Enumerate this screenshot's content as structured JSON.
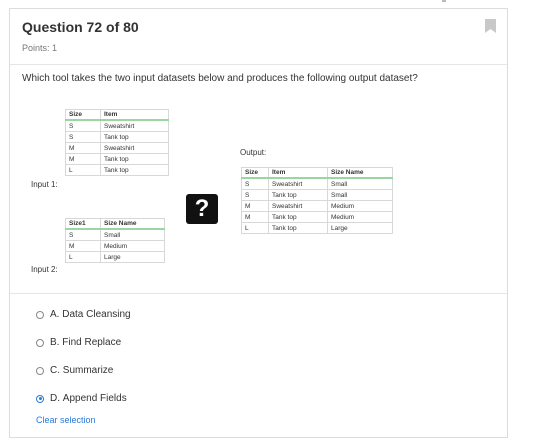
{
  "header": {
    "title": "Question 72 of 80",
    "points": "Points: 1"
  },
  "question": "Which tool takes the two input datasets below and produces the following output dataset?",
  "input1": {
    "label": "Input 1:",
    "headers": [
      "Size",
      "Item"
    ],
    "rows": [
      [
        "S",
        "Sweatshirt"
      ],
      [
        "S",
        "Tank top"
      ],
      [
        "M",
        "Sweatshirt"
      ],
      [
        "M",
        "Tank top"
      ],
      [
        "L",
        "Tank top"
      ]
    ]
  },
  "input2": {
    "label": "Input 2:",
    "headers": [
      "Size1",
      "Size Name"
    ],
    "rows": [
      [
        "S",
        "Small"
      ],
      [
        "M",
        "Medium"
      ],
      [
        "L",
        "Large"
      ]
    ]
  },
  "output": {
    "label": "Output:",
    "headers": [
      "Size",
      "Item",
      "Size Name"
    ],
    "rows": [
      [
        "S",
        "Sweatshirt",
        "Small"
      ],
      [
        "S",
        "Tank top",
        "Small"
      ],
      [
        "M",
        "Sweatshirt",
        "Medium"
      ],
      [
        "M",
        "Tank top",
        "Medium"
      ],
      [
        "L",
        "Tank top",
        "Large"
      ]
    ]
  },
  "mystery": {
    "glyph": "?"
  },
  "options": [
    {
      "letter": "A.",
      "text": "Data Cleansing",
      "selected": false
    },
    {
      "letter": "B.",
      "text": "Find Replace",
      "selected": false
    },
    {
      "letter": "C.",
      "text": "Summarize",
      "selected": false
    },
    {
      "letter": "D.",
      "text": "Append Fields",
      "selected": true
    }
  ],
  "clear_label": "Clear selection",
  "icons": {
    "bookmark": "bookmark-icon"
  },
  "colors": {
    "accent": "#2a7ad8",
    "header_rule": "#9ad7a0"
  }
}
